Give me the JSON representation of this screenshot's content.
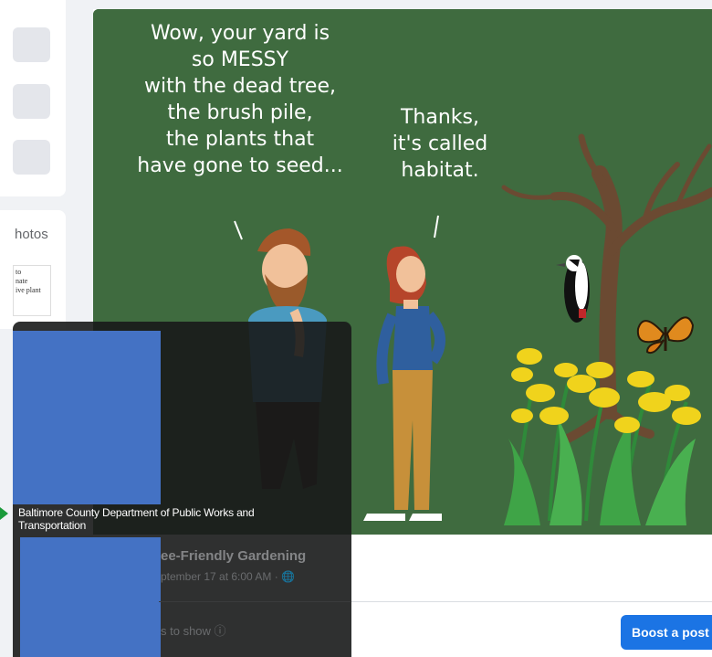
{
  "sidebar": {
    "photos_label": "hotos",
    "thumbnail_text": "to\nnate\nive plant"
  },
  "post": {
    "left_speech": "Wow, your yard is\nso MESSY\nwith the dead tree,\nthe brush pile,\nthe plants that\nhave gone to seed...",
    "right_speech": "Thanks,\nit's called\nhabitat.",
    "boost_label": "Boost a post"
  },
  "hover_card": {
    "name": "Baltimore County Department of Public Works and Transportation",
    "page_fragment": "ee-Friendly Gardening",
    "meta_fragment": "ptember 17 at 6:00 AM · ",
    "empty_fragment": "s to show"
  },
  "colors": {
    "image_bg": "#3f6b3f",
    "boost_blue": "#1b74e4",
    "redaction_blue": "#4472c4"
  }
}
